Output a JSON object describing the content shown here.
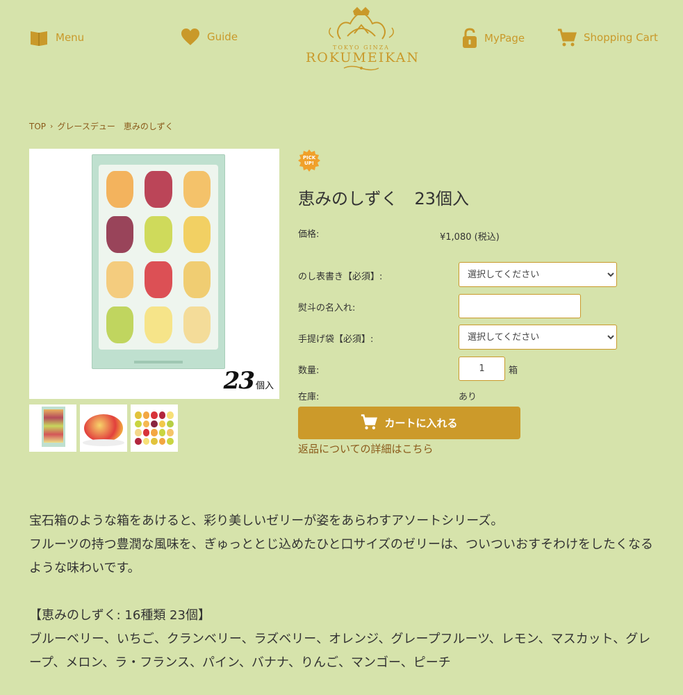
{
  "header": {
    "menu_label": "Menu",
    "guide_label": "Guide",
    "mypage_label": "MyPage",
    "cart_label": "Shopping Cart",
    "logo_small": "TOKYO GINZA",
    "logo_big": "ROKUMEIKAN"
  },
  "breadcrumb": {
    "top": "TOP",
    "current": "グレースデュー　恵みのしずく"
  },
  "product": {
    "count_num": "23",
    "count_unit": "個入",
    "pickup_text": "PICK UP!",
    "title": "恵みのしずく　23個入",
    "price_label": "価格:",
    "price_value": "¥1,080 (税込)",
    "noshi_label": "のし表書き【必須】:",
    "noshi_selected": "選択してください",
    "name_label": "熨斗の名入れ:",
    "name_value": "",
    "bag_label": "手提げ袋【必須】:",
    "bag_selected": "選択してください",
    "qty_label": "数量:",
    "qty_value": "1",
    "qty_unit": "箱",
    "stock_label": "在庫:",
    "stock_value": "あり",
    "cart_button": "カートに入れる",
    "return_link": "返品についての詳細はこちら"
  },
  "description": {
    "line1": "宝石箱のような箱をあけると、彩り美しいゼリーが姿をあらわすアソートシリーズ。",
    "line2": "フルーツの持つ豊潤な風味を、ぎゅっととじ込めたひと口サイズのゼリーは、ついついおすそわけをしたくなるような味わいです。",
    "heading": "【恵みのしずく: 16種類 23個】",
    "flavors": "ブルーベリー、いちご、クランベリー、ラズベリー、オレンジ、グレープフルーツ、レモン、マスカット、グレープ、メロン、ラ・フランス、パイン、バナナ、りんご、マンゴー、ピーチ"
  },
  "colors": {
    "background": "#d6e3ab",
    "accent": "#c9992a",
    "link": "#8a5a1a"
  }
}
